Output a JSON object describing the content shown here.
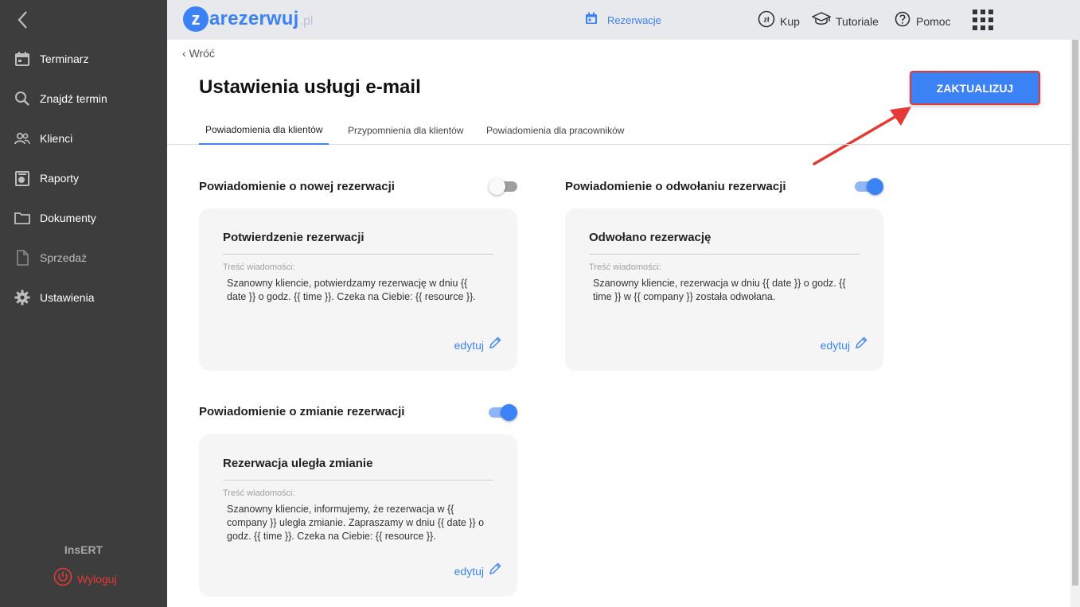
{
  "sidebar": {
    "items": [
      {
        "label": "Terminarz",
        "icon": "calendar-icon"
      },
      {
        "label": "Znajdź termin",
        "icon": "search-icon"
      },
      {
        "label": "Klienci",
        "icon": "people-icon"
      },
      {
        "label": "Raporty",
        "icon": "report-icon"
      },
      {
        "label": "Dokumenty",
        "icon": "folder-icon"
      },
      {
        "label": "Sprzedaż",
        "icon": "document-icon"
      },
      {
        "label": "Ustawienia",
        "icon": "gear-icon"
      }
    ],
    "brand": "InsERT",
    "logout_label": "Wyloguj"
  },
  "topbar": {
    "logo_letter": "z",
    "logo_word": "arezerwuj",
    "logo_tld": ".pl",
    "reservations_label": "Rezerwacje",
    "buy_label": "Kup",
    "tutorials_label": "Tutoriale",
    "help_label": "Pomoc"
  },
  "page": {
    "back_label": "Wróć",
    "title": "Ustawienia usługi e-mail",
    "update_label": "ZAKTUALIZUJ"
  },
  "tabs": [
    {
      "label": "Powiadomienia dla klientów",
      "active": true
    },
    {
      "label": "Przypomnienia dla klientów",
      "active": false
    },
    {
      "label": "Powiadomienia dla pracowników",
      "active": false
    }
  ],
  "sections": [
    {
      "title": "Powiadomienie o nowej rezerwacji",
      "enabled": false,
      "card_title": "Potwierdzenie rezerwacji",
      "content_label": "Treść wiadomości:",
      "content": "Szanowny kliencie, potwierdzamy rezerwację w dniu {{ date }} o godz. {{ time }}. Czeka na Ciebie: {{ resource }}.",
      "edit_label": "edytuj"
    },
    {
      "title": "Powiadomienie o odwołaniu rezerwacji",
      "enabled": true,
      "card_title": "Odwołano rezerwację",
      "content_label": "Treść wiadomości:",
      "content": "Szanowny kliencie, rezerwacja w dniu {{ date }} o godz. {{ time }} w {{ company }} została odwołana.",
      "edit_label": "edytuj"
    },
    {
      "title": "Powiadomienie o zmianie rezerwacji",
      "enabled": true,
      "card_title": "Rezerwacja uległa zmianie",
      "content_label": "Treść wiadomości:",
      "content": "Szanowny kliencie, informujemy, że rezerwacja w {{ company }} uległa zmianie. Zapraszamy w dniu {{ date }} o godz. {{ time }}. Czeka na Ciebie: {{ resource }}.",
      "edit_label": "edytuj"
    }
  ],
  "colors": {
    "accent": "#3b82f6",
    "sidebar_bg": "#3d3d3d",
    "topbar_bg": "#e8e9ec",
    "highlight": "#e53935"
  }
}
